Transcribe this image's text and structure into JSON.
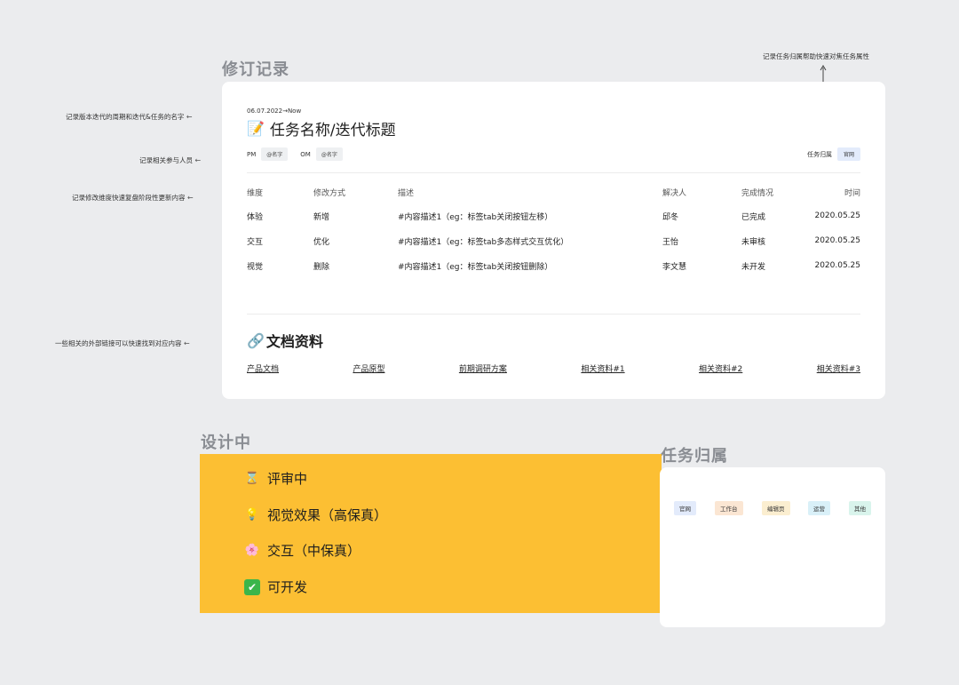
{
  "sections": {
    "revision_label": "修订记录",
    "design_label": "设计中",
    "belong_label": "任务归属"
  },
  "annotations": {
    "top_right": "记录任务归属帮助快速对焦任务属性",
    "period": "记录版本迭代的周期和迭代&任务的名字",
    "people": "记录相关参与人员",
    "dimension": "记录修改维度快速复盘阶段性更新内容",
    "links": "一些相关的外部链接可以快速找到对应内容",
    "arrow": "←"
  },
  "revision": {
    "date": "06.07.2022→Now",
    "title": "任务名称/迭代标题",
    "title_emoji": "📝",
    "pm_label": "PM",
    "pm_name": "@名字",
    "om_label": "OM",
    "om_name": "@名字",
    "owner_label": "任务归属",
    "owner_tag": "官网",
    "table": {
      "headers": [
        "维度",
        "修改方式",
        "描述",
        "解决人",
        "完成情况",
        "时间"
      ],
      "rows": [
        [
          "体验",
          "新增",
          "#内容描述1（eg：标签tab关闭按钮左移）",
          "邱冬",
          "已完成",
          "2020.05.25"
        ],
        [
          "交互",
          "优化",
          "#内容描述1（eg：标签tab多态样式交互优化）",
          "王怡",
          "未审核",
          "2020.05.25"
        ],
        [
          "视觉",
          "删除",
          "#内容描述1（eg：标签tab关闭按钮删除）",
          "李文慧",
          "未开发",
          "2020.05.25"
        ]
      ]
    },
    "docs_emoji": "🔗",
    "docs_title": "文档资料",
    "doc_links": [
      "产品文档",
      "产品原型",
      "前期调研方案",
      "相关资料#1",
      "相关资料#2",
      "相关资料#3"
    ]
  },
  "status": {
    "items": [
      {
        "icon": "hourglass-icon",
        "glyph": "⌛",
        "label": "评审中"
      },
      {
        "icon": "lightbulb-icon",
        "glyph": "💡",
        "label": "视觉效果（高保真）"
      },
      {
        "icon": "flower-icon",
        "glyph": "🌸",
        "label": "交互（中保真）"
      },
      {
        "icon": "check-icon",
        "glyph": "✔",
        "label": "可开发"
      }
    ],
    "background": "#fcbf33"
  },
  "belong": {
    "tags": [
      {
        "label": "官网",
        "color": "#e3ebfb"
      },
      {
        "label": "工作台",
        "color": "#fbe6d3"
      },
      {
        "label": "编辑页",
        "color": "#fbeed0"
      },
      {
        "label": "运营",
        "color": "#d9f0f8"
      },
      {
        "label": "其他",
        "color": "#d9f4ec"
      }
    ]
  }
}
